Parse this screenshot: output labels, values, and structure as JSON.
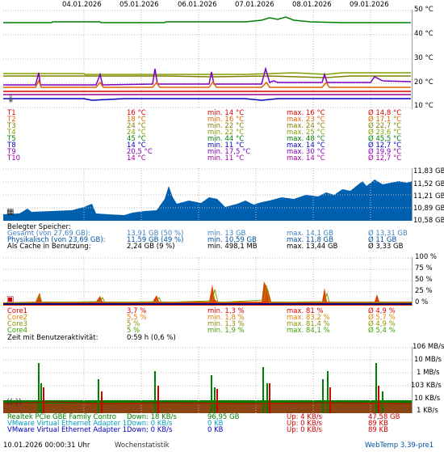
{
  "dates": [
    "04.01.2026",
    "05.01.2026",
    "06.01.2026",
    "07.01.2026",
    "08.01.2026",
    "09.01.2026"
  ],
  "temp": {
    "y_ticks": [
      "50 °C",
      "40 °C",
      "30 °C",
      "20 °C",
      "10 °C"
    ],
    "rows": [
      {
        "label": "T1",
        "cur": "16 °C",
        "min": "min. 14 °C",
        "max": "max. 16 °C",
        "avg": "Ø 14,8 °C",
        "color": "#d80000"
      },
      {
        "label": "T2",
        "cur": "18 °C",
        "min": "min. 16 °C",
        "max": "max. 23 °C",
        "avg": "Ø 17,1 °C",
        "color": "#e06000"
      },
      {
        "label": "T3",
        "cur": "24 °C",
        "min": "min. 22 °C",
        "max": "max. 24 °C",
        "avg": "Ø 22,7 °C",
        "color": "#808000"
      },
      {
        "label": "T4",
        "cur": "24 °C",
        "min": "min. 22 °C",
        "max": "max. 25 °C",
        "avg": "Ø 23,6 °C",
        "color": "#80a000"
      },
      {
        "label": "T5",
        "cur": "45 °C",
        "min": "min. 44 °C",
        "max": "max. 48 °C",
        "avg": "Ø 45,5 °C",
        "color": "#008000"
      },
      {
        "label": "T8",
        "cur": "14 °C",
        "min": "min. 11 °C",
        "max": "max. 14 °C",
        "avg": "Ø 12,7 °C",
        "color": "#0000c0"
      },
      {
        "label": "T9",
        "cur": "20,5 °C",
        "min": "min. 17,5 °C",
        "max": "max. 30 °C",
        "avg": "Ø 19,9 °C",
        "color": "#8000c0"
      },
      {
        "label": "T10",
        "cur": "14 °C",
        "min": "min. 11 °C",
        "max": "max. 14 °C",
        "avg": "Ø 12,7 °C",
        "color": "#a000a0"
      }
    ]
  },
  "memory": {
    "y_ticks": [
      "11,83 GB",
      "11,52 GB",
      "11,21 GB",
      "10,89 GB",
      "10,58 GB"
    ],
    "header": "Belegter Speicher:",
    "rows": [
      {
        "label": "Gesamt (von 27,69 GB):",
        "cur": "13,91 GB (50 %)",
        "min": "min. 13 GB",
        "max": "max. 14,1 GB",
        "avg": "Ø 13,31 GB",
        "color": "#4080c0"
      },
      {
        "label": "Physikalisch (von 23,69 GB):",
        "cur": "11,59 GB (49 %)",
        "min": "min. 10,59 GB",
        "max": "max. 11,8 GB",
        "avg": "Ø 11 GB",
        "color": "#0050a0"
      },
      {
        "label": "Als Cache in Benutzung:",
        "cur": "2,24 GB (9 %)",
        "min": "min. 498,1 MB",
        "max": "max. 13,44 GB",
        "avg": "Ø 3,33 GB",
        "color": "#000000"
      }
    ]
  },
  "cpu": {
    "y_ticks": [
      "100 %",
      "75 %",
      "50 %",
      "25 %",
      "0 %"
    ],
    "rows": [
      {
        "label": "Core1",
        "cur": "3,7 %",
        "min": "min. 1,3 %",
        "max": "max. 81 %",
        "avg": "Ø 4,9 %",
        "color": "#d80000"
      },
      {
        "label": "Core2",
        "cur": "5,5 %",
        "min": "min. 1,8 %",
        "max": "max. 83,2 %",
        "avg": "Ø 5,7 %",
        "color": "#e08000"
      },
      {
        "label": "Core3",
        "cur": "5 %",
        "min": "min. 1,3 %",
        "max": "max. 81,4 %",
        "avg": "Ø 4,9 %",
        "color": "#909000"
      },
      {
        "label": "Core4",
        "cur": "5 %",
        "min": "min. 1,9 %",
        "max": "max. 84,1 %",
        "avg": "Ø 5,4 %",
        "color": "#40a000"
      }
    ],
    "activity_label": "Zeit mit Benutzeraktivität:",
    "activity_value": "0:59 h (0,6 %)"
  },
  "net": {
    "y_ticks": [
      "106 MB/s",
      "10 MB/s",
      "1 MB/s",
      "103 KB/s",
      "10 KB/s",
      "1 KB/s"
    ],
    "rows": [
      {
        "label": "Realtek PCIe GBE Family Contro",
        "down": "Down: 18 KB/s",
        "down_total": "96,95 GB",
        "up": "Up: 4 KB/s",
        "up_total": "47,58 GB",
        "color": "#008000"
      },
      {
        "label": "VMware Virtual Ethernet Adapter 1",
        "down": "Down: 0 KB/s",
        "down_total": "0 KB",
        "up": "Up: 0 KB/s",
        "up_total": "89 KB",
        "color": "#00a0c0"
      },
      {
        "label": "VMware Virtual Ethernet Adapter 1",
        "down": "Down: 0 KB/s",
        "down_total": "0 KB",
        "up": "Up: 0 KB/s",
        "up_total": "89 KB",
        "color": "#0000c0"
      }
    ]
  },
  "footer": {
    "timestamp": "10.01.2026 00:00:31 Uhr",
    "stats_link": "Wochenstatistik",
    "version": "WebTemp 3.39-pre1"
  },
  "colors": {
    "up_color": "#d00000",
    "down_color": "#008000"
  }
}
